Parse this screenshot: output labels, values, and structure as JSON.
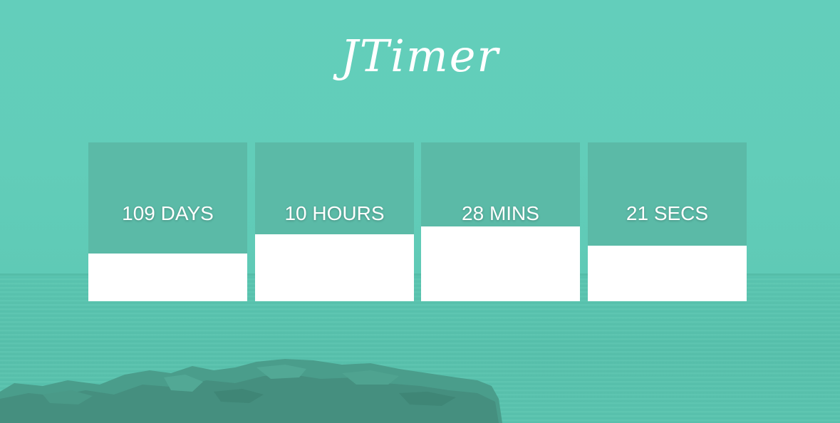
{
  "app": {
    "title": "JTimer"
  },
  "countdown": [
    {
      "id": "days",
      "label": "109 DAYS",
      "progress": 0.3
    },
    {
      "id": "hours",
      "label": "10 HOURS",
      "progress": 0.42
    },
    {
      "id": "mins",
      "label": "28 MINS",
      "progress": 0.47
    },
    {
      "id": "secs",
      "label": "21 SECS",
      "progress": 0.35
    }
  ],
  "colors": {
    "background": "#62cdb9",
    "card": "#5bbaa7",
    "fill": "#ffffff",
    "text": "#ffffff"
  }
}
